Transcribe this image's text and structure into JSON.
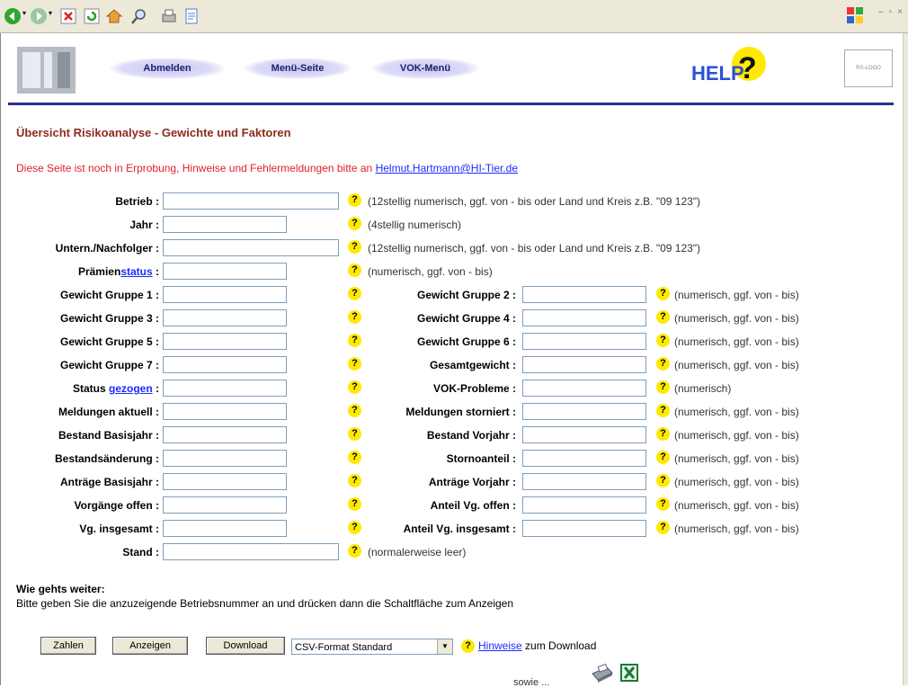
{
  "browser": {
    "toolbar_icons": [
      "back-icon",
      "forward-icon",
      "stop-icon",
      "refresh-icon",
      "home-icon",
      "search-icon",
      "print-icon",
      "edit-icon"
    ]
  },
  "header": {
    "nav": [
      "Abmelden",
      "Menü-Seite",
      "VOK-Menü"
    ],
    "help_logo_text": "HELP",
    "rs_logo_text": "RS-LOGO"
  },
  "page": {
    "title": "Übersicht Risikoanalyse - Gewichte und Faktoren",
    "notice_text": "Diese Seite ist noch in Erprobung, Hinweise und Fehlermeldungen bitte an ",
    "notice_email": "Helmut.Hartmann@HI-Tier.de"
  },
  "form": {
    "betrieb": {
      "label": "Betrieb :",
      "hint": "(12stellig numerisch, ggf. von - bis oder Land und Kreis z.B. \"09 123\")"
    },
    "jahr": {
      "label": "Jahr :",
      "hint": "(4stellig numerisch)"
    },
    "nachfolger": {
      "label": "Untern./Nachfolger :",
      "hint": "(12stellig numerisch, ggf. von - bis oder Land und Kreis z.B. \"09 123\")"
    },
    "praemien": {
      "label_prefix": "Prämien",
      "label_link": "status",
      "label_suffix": " :",
      "hint": "(numerisch, ggf. von - bis)"
    },
    "pairs": [
      {
        "left": "Gewicht Gruppe 1 :",
        "right": "Gewicht Gruppe 2 :",
        "hint": "(numerisch, ggf. von - bis)"
      },
      {
        "left": "Gewicht Gruppe 3 :",
        "right": "Gewicht Gruppe 4 :",
        "hint": "(numerisch, ggf. von - bis)"
      },
      {
        "left": "Gewicht Gruppe 5 :",
        "right": "Gewicht Gruppe 6 :",
        "hint": "(numerisch, ggf. von - bis)"
      },
      {
        "left": "Gewicht Gruppe 7 :",
        "right": "Gesamtgewicht :",
        "hint": "(numerisch, ggf. von - bis)"
      },
      {
        "left_prefix": "Status ",
        "left_link": "gezogen",
        "left_suffix": " :",
        "right": "VOK-Probleme :",
        "hint": "(numerisch)"
      },
      {
        "left": "Meldungen aktuell :",
        "right": "Meldungen storniert :",
        "hint": "(numerisch, ggf. von - bis)"
      },
      {
        "left": "Bestand Basisjahr :",
        "right": "Bestand Vorjahr :",
        "hint": "(numerisch, ggf. von - bis)"
      },
      {
        "left": "Bestandsänderung :",
        "right": "Stornoanteil :",
        "hint": "(numerisch, ggf. von - bis)"
      },
      {
        "left": "Anträge Basisjahr :",
        "right": "Anträge Vorjahr :",
        "hint": "(numerisch, ggf. von - bis)"
      },
      {
        "left": "Vorgänge offen :",
        "right": "Anteil Vg. offen :",
        "hint": "(numerisch, ggf. von - bis)"
      },
      {
        "left": "Vg. insgesamt :",
        "right": "Anteil Vg. insgesamt :",
        "hint": "(numerisch, ggf. von - bis)"
      }
    ],
    "stand": {
      "label": "Stand :",
      "hint": "(normalerweise leer)"
    },
    "help_glyph": "?"
  },
  "howto": {
    "title": "Wie gehts weiter:",
    "text": "Bitte geben Sie die anzuzeigende Betriebsnummer an und drücken dann die Schaltfläche zum Anzeigen"
  },
  "actions": {
    "zahlen": "Zahlen",
    "anzeigen": "Anzeigen",
    "download": "Download",
    "format_selected": "CSV-Format Standard",
    "dl_hint_link": "Hinweise",
    "dl_hint_text": " zum Download",
    "sowie": "sowie ..."
  },
  "colors": {
    "title": "#8b2d1c",
    "notice": "#e0212a",
    "link": "#1a2cff",
    "rule": "#2a2f8f",
    "help_badge": "#ffe900"
  }
}
